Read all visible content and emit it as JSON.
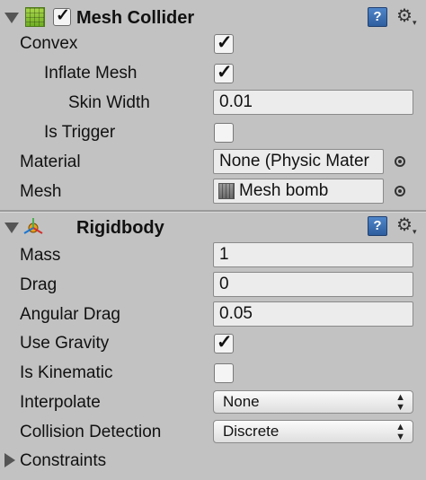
{
  "mesh_collider": {
    "title": "Mesh Collider",
    "enabled": true,
    "convex": {
      "label": "Convex",
      "checked": true,
      "mark": "✓"
    },
    "inflate_mesh": {
      "label": "Inflate Mesh",
      "checked": true,
      "mark": "✓"
    },
    "skin_width": {
      "label": "Skin Width",
      "value": "0.01"
    },
    "is_trigger": {
      "label": "Is Trigger",
      "checked": false
    },
    "material": {
      "label": "Material",
      "value": "None (Physic Mater"
    },
    "mesh": {
      "label": "Mesh",
      "value": "Mesh bomb"
    },
    "help_glyph": "?",
    "gear_glyph": "⚙",
    "caret_glyph": "▾",
    "enable_mark": "✓"
  },
  "rigidbody": {
    "title": "Rigidbody",
    "mass": {
      "label": "Mass",
      "value": "1"
    },
    "drag": {
      "label": "Drag",
      "value": "0"
    },
    "angular_drag": {
      "label": "Angular Drag",
      "value": "0.05"
    },
    "use_gravity": {
      "label": "Use Gravity",
      "checked": true,
      "mark": "✓"
    },
    "is_kinematic": {
      "label": "Is Kinematic",
      "checked": false
    },
    "interpolate": {
      "label": "Interpolate",
      "value": "None"
    },
    "collision_detection": {
      "label": "Collision Detection",
      "value": "Discrete"
    },
    "constraints": {
      "label": "Constraints",
      "expanded": false
    },
    "help_glyph": "?",
    "gear_glyph": "⚙",
    "caret_glyph": "▾",
    "dropdown_arrows": "▲▼"
  },
  "colors": {
    "panel_bg": "#c2c2c2",
    "field_bg": "#ececec",
    "mesh_icon_green": "#8cc63f",
    "help_blue": "#3d72b8"
  }
}
